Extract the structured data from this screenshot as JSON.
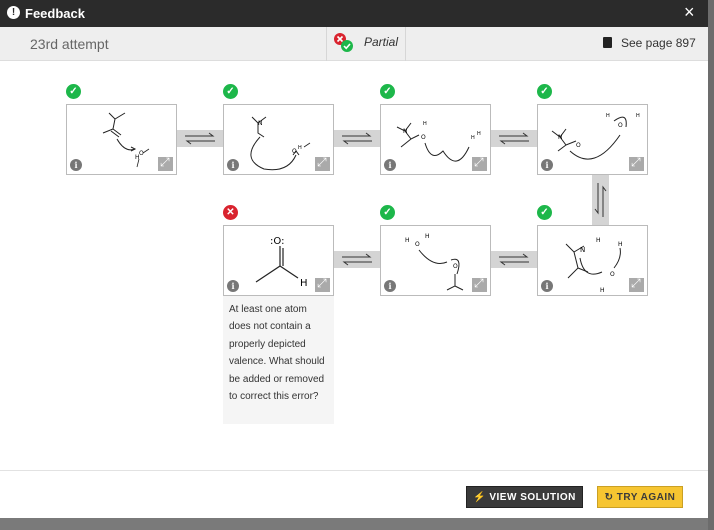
{
  "titlebar": {
    "title": "Feedback",
    "info_icon": "!",
    "close_icon": "×"
  },
  "subbar": {
    "attempt": "23rd attempt",
    "status": "Partial",
    "page_ref": "See page 897"
  },
  "colors": {
    "correct": "#1db74a",
    "incorrect": "#d9232e",
    "accent_button": "#f6c531",
    "dark_button": "#3a3a3a",
    "titlebar_bg": "#2b2b2b"
  },
  "steps": [
    {
      "status": "correct",
      "badge": "✓"
    },
    {
      "status": "correct",
      "badge": "✓"
    },
    {
      "status": "correct",
      "badge": "✓"
    },
    {
      "status": "correct",
      "badge": "✓"
    },
    {
      "status": "correct",
      "badge": "✓"
    },
    {
      "status": "correct",
      "badge": "✓"
    },
    {
      "status": "incorrect",
      "badge": "✕"
    }
  ],
  "card_icons": {
    "info": "i",
    "expand": "expand-icon"
  },
  "error_message": "At least one atom does not contain a properly depicted valence. What should be added or removed to correct this error?",
  "footer": {
    "view_solution": "VIEW SOLUTION",
    "view_solution_icon": "⚡",
    "try_again": "TRY AGAIN",
    "try_again_icon": "↻"
  }
}
